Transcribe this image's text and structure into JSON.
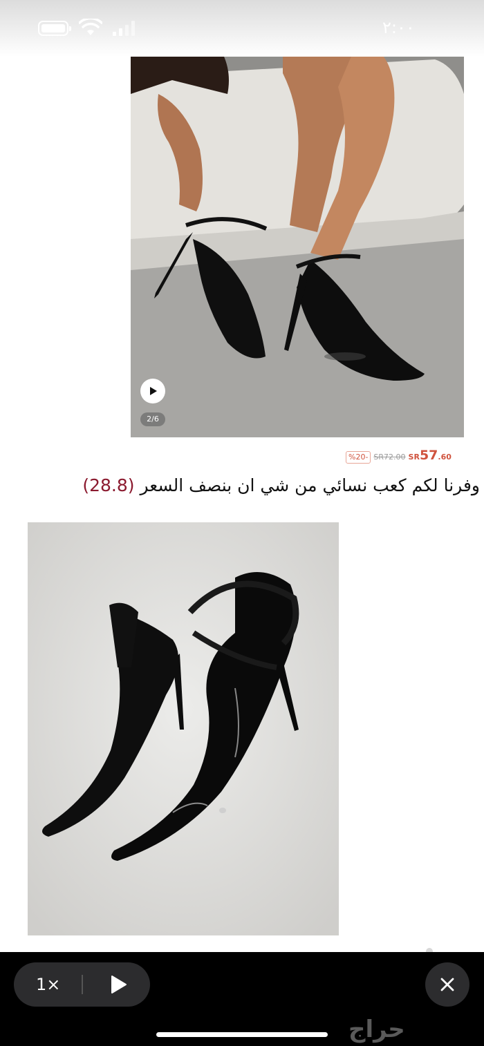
{
  "status_bar": {
    "time": "٢:٠٠"
  },
  "product_photo": {
    "page_counter": "2/6"
  },
  "price": {
    "discount": "%20-",
    "old_price": "SR72.00",
    "currency": "SR",
    "new_price_int": "57",
    "new_price_dec": ".60"
  },
  "caption": {
    "text": "وفرنا لكم كعب نسائي من شي ان بنصف السعر",
    "highlight": "(28.8)"
  },
  "player": {
    "speed": "1×"
  },
  "watermark": {
    "text": "حراج"
  },
  "icons": [
    "battery-icon",
    "wifi-icon",
    "signal-icon",
    "play-icon",
    "close-icon"
  ]
}
